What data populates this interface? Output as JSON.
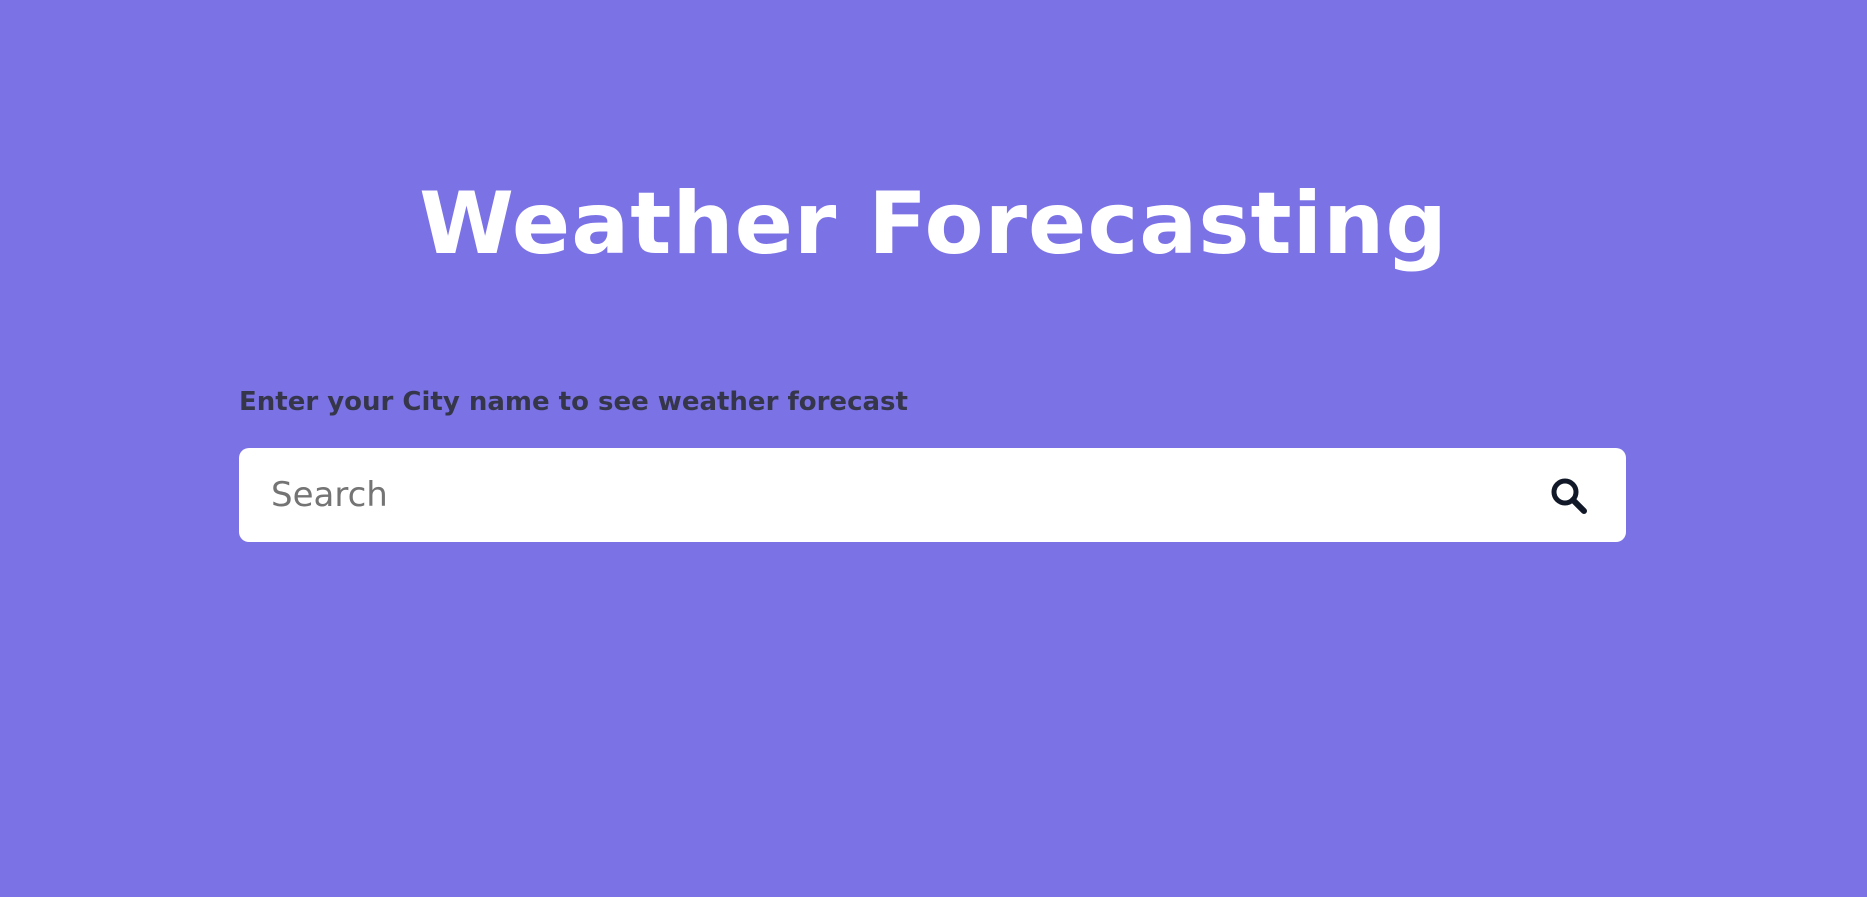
{
  "header": {
    "title": "Weather Forecasting"
  },
  "search": {
    "label": "Enter your City name to see weather forecast",
    "placeholder": "Search",
    "value": "",
    "button_icon": "search-icon"
  },
  "colors": {
    "background": "#7b72e6",
    "title": "#ffffff",
    "label": "#36364a",
    "search_box": "#ffffff",
    "icon": "#111827"
  }
}
